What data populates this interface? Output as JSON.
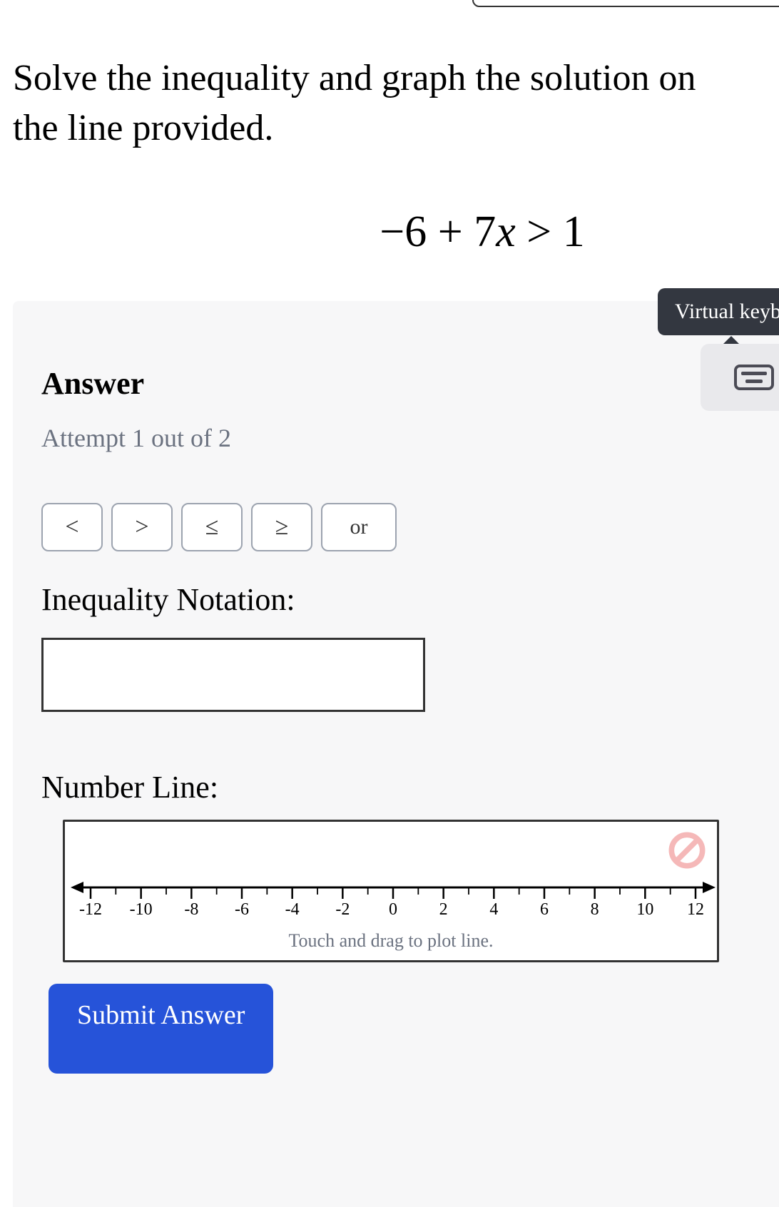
{
  "question": "Solve the inequality and graph the solution on the line provided.",
  "equation": {
    "lhs_pre": "−6 + 7",
    "var": "x",
    "op": " > ",
    "rhs": "1"
  },
  "answer_heading": "Answer",
  "attempt": "Attempt 1 out of 2",
  "symbols": {
    "lt": "<",
    "gt": ">",
    "le": "≤",
    "ge": "≥",
    "or": "or"
  },
  "inequality_label": "Inequality Notation:",
  "inequality_value": "",
  "numberline_label": "Number Line:",
  "numberline": {
    "min": -12,
    "max": 12,
    "major_step": 2,
    "ticks": [
      "-12",
      "-10",
      "-8",
      "-6",
      "-4",
      "-2",
      "0",
      "2",
      "4",
      "6",
      "8",
      "10",
      "12"
    ],
    "hint": "Touch and drag to plot line."
  },
  "submit_label": "Submit Answer",
  "tooltip": "Virtual keybo",
  "chart_data": {
    "type": "numberline",
    "range": [
      -12,
      12
    ],
    "tick_values": [
      -12,
      -10,
      -8,
      -6,
      -4,
      -2,
      0,
      2,
      4,
      6,
      8,
      10,
      12
    ],
    "plotted": null,
    "instruction": "Touch and drag to plot line."
  }
}
